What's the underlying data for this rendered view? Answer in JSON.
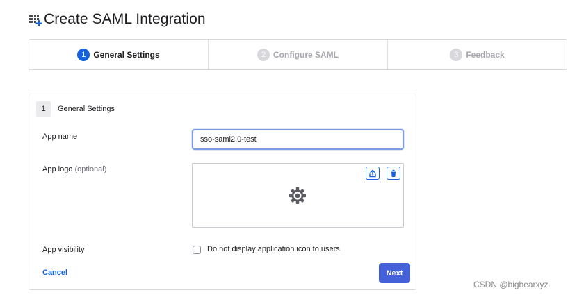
{
  "page": {
    "title": "Create SAML Integration",
    "title_icon": "app-grid-add-icon"
  },
  "stepper": {
    "steps": [
      {
        "num": "1",
        "label": "General Settings",
        "state": "active"
      },
      {
        "num": "2",
        "label": "Configure SAML",
        "state": "inactive"
      },
      {
        "num": "3",
        "label": "Feedback",
        "state": "inactive"
      }
    ]
  },
  "form": {
    "section_num": "1",
    "section_title": "General Settings",
    "app_name_label": "App name",
    "app_name_value": "sso-saml2.0-test",
    "app_logo_label": "App logo",
    "app_logo_optional": "(optional)",
    "logo_placeholder_icon": "gear-icon",
    "upload_icon": "upload-icon",
    "delete_icon": "trash-icon",
    "app_visibility_label": "App visibility",
    "visibility_checkbox_label": "Do not display application icon to users",
    "visibility_checked": false,
    "cancel_label": "Cancel",
    "next_label": "Next"
  },
  "watermark": "CSDN @bigbearxyz",
  "colors": {
    "primary": "#1662dd",
    "next_button": "#4461d9",
    "inactive_step": "#d7d7dc",
    "border": "#d7d7dc"
  }
}
